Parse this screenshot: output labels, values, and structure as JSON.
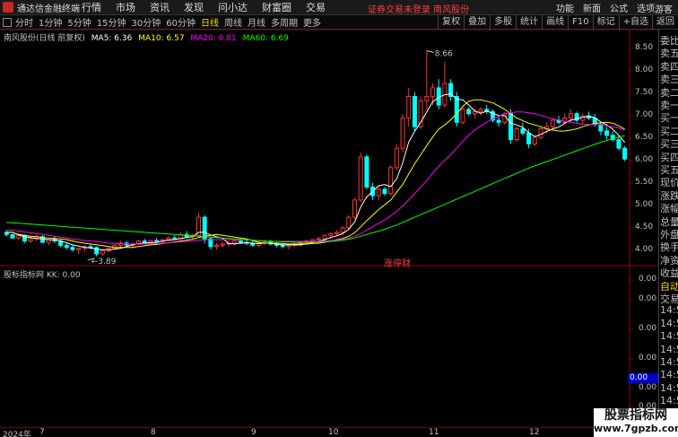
{
  "menubar": {
    "app_title": "通达信金融终端",
    "items": [
      "行情",
      "市场",
      "资讯",
      "发现",
      "问小达",
      "财富圈",
      "交易"
    ],
    "alert": "证券交易未登录  南风股份",
    "right_items": [
      "功能",
      "新面",
      "公式",
      "选项"
    ],
    "guest": "游客"
  },
  "toolbar": {
    "periods": [
      "分时",
      "1分钟",
      "5分钟",
      "15分钟",
      "30分钟",
      "60分钟",
      "日线",
      "周线",
      "月线",
      "多周期",
      "更多"
    ],
    "active_period": 6,
    "tools": [
      "复权",
      "叠加",
      "多股",
      "统计",
      "画线",
      "F10",
      "标记",
      "+自选",
      "返回"
    ]
  },
  "legend": {
    "stock": "南风股份(日线 前复权)",
    "ma5": "MA5: 6.36",
    "ma10": "MA10: 6.57",
    "ma20": "MA20: 6.81",
    "ma60": "MA60: 6.69"
  },
  "indicator": {
    "legend": "股标指标网  KK: 0.00",
    "value_box": "0.00"
  },
  "annotations": {
    "high": "8.66",
    "low": "3.89",
    "zhang_ting": "涨停财"
  },
  "price_axis": [
    "8.50",
    "8.00",
    "7.50",
    "7.00",
    "6.50",
    "6.00",
    "5.50",
    "5.00",
    "4.50",
    "4.00"
  ],
  "ind_axis": [
    "0.00",
    "0.00",
    "0.00",
    "0.00",
    "0.00",
    "0.00",
    "0.00"
  ],
  "side_labels": [
    "委比",
    "卖五",
    "卖四",
    "卖三",
    "卖二",
    "卖一",
    "买一",
    "买二",
    "买三",
    "买四",
    "买五",
    "现价",
    "涨跌",
    "涨幅",
    "总量",
    "外盘",
    "换手",
    "净资",
    "收益",
    "自动",
    "交易",
    "14:56",
    "14:56",
    "14:56",
    "14:56",
    "14:56",
    "14:56",
    "14:56",
    "14:56",
    "14:56"
  ],
  "date_axis": [
    "2024年",
    "7",
    "8",
    "9",
    "10",
    "11",
    "12"
  ],
  "watermark": {
    "line1": "股票指标网",
    "line2": "www.7gpzb.com"
  },
  "colors": {
    "up": "#ff3232",
    "down": "#00ffff",
    "ma5": "#ffffff",
    "ma10": "#ffff00",
    "ma20": "#ff00ff",
    "ma60": "#00ff00"
  },
  "chart_data": {
    "type": "candlestick",
    "ylim": [
      3.7,
      8.9
    ],
    "candles": [
      [
        4.45,
        4.5,
        4.35,
        4.4
      ],
      [
        4.4,
        4.42,
        4.3,
        4.32
      ],
      [
        4.32,
        4.4,
        4.28,
        4.38
      ],
      [
        4.38,
        4.4,
        4.2,
        4.25
      ],
      [
        4.25,
        4.35,
        4.2,
        4.3
      ],
      [
        4.3,
        4.4,
        4.25,
        4.35
      ],
      [
        4.35,
        4.38,
        4.2,
        4.22
      ],
      [
        4.22,
        4.3,
        4.15,
        4.28
      ],
      [
        4.28,
        4.35,
        4.2,
        4.25
      ],
      [
        4.25,
        4.3,
        4.1,
        4.15
      ],
      [
        4.15,
        4.2,
        4.05,
        4.1
      ],
      [
        4.1,
        4.15,
        4.0,
        4.05
      ],
      [
        4.05,
        4.1,
        3.95,
        4.08
      ],
      [
        4.08,
        4.15,
        4.0,
        4.12
      ],
      [
        4.12,
        4.18,
        4.05,
        4.1
      ],
      [
        4.1,
        4.12,
        3.89,
        3.95
      ],
      [
        3.95,
        4.05,
        3.9,
        4.02
      ],
      [
        4.02,
        4.1,
        3.98,
        4.08
      ],
      [
        4.08,
        4.18,
        4.05,
        4.15
      ],
      [
        4.15,
        4.25,
        4.1,
        4.2
      ],
      [
        4.2,
        4.25,
        4.12,
        4.15
      ],
      [
        4.15,
        4.2,
        4.08,
        4.18
      ],
      [
        4.18,
        4.28,
        4.15,
        4.25
      ],
      [
        4.25,
        4.3,
        4.2,
        4.22
      ],
      [
        4.22,
        4.28,
        4.18,
        4.26
      ],
      [
        4.26,
        4.32,
        4.2,
        4.24
      ],
      [
        4.24,
        4.3,
        4.2,
        4.28
      ],
      [
        4.28,
        4.35,
        4.25,
        4.32
      ],
      [
        4.32,
        4.38,
        4.28,
        4.3
      ],
      [
        4.3,
        4.45,
        4.28,
        4.4
      ],
      [
        4.4,
        4.48,
        4.32,
        4.35
      ],
      [
        4.35,
        4.42,
        4.3,
        4.38
      ],
      [
        4.38,
        4.9,
        4.35,
        4.8
      ],
      [
        4.8,
        4.85,
        4.2,
        4.3
      ],
      [
        4.3,
        4.35,
        4.05,
        4.12
      ],
      [
        4.12,
        4.2,
        4.05,
        4.15
      ],
      [
        4.15,
        4.22,
        4.1,
        4.18
      ],
      [
        4.18,
        4.25,
        4.12,
        4.2
      ],
      [
        4.2,
        4.28,
        4.15,
        4.25
      ],
      [
        4.25,
        4.3,
        4.18,
        4.22
      ],
      [
        4.22,
        4.28,
        4.15,
        4.2
      ],
      [
        4.2,
        4.25,
        4.12,
        4.15
      ],
      [
        4.15,
        4.22,
        4.1,
        4.2
      ],
      [
        4.2,
        4.28,
        4.15,
        4.22
      ],
      [
        4.22,
        4.28,
        4.15,
        4.18
      ],
      [
        4.18,
        4.22,
        4.1,
        4.15
      ],
      [
        4.15,
        4.2,
        4.08,
        4.12
      ],
      [
        4.12,
        4.18,
        4.05,
        4.15
      ],
      [
        4.15,
        4.2,
        4.1,
        4.18
      ],
      [
        4.18,
        4.25,
        4.12,
        4.2
      ],
      [
        4.2,
        4.28,
        4.15,
        4.25
      ],
      [
        4.25,
        4.3,
        4.2,
        4.28
      ],
      [
        4.28,
        4.35,
        4.22,
        4.3
      ],
      [
        4.3,
        4.4,
        4.25,
        4.38
      ],
      [
        4.38,
        4.45,
        4.3,
        4.42
      ],
      [
        4.42,
        4.5,
        4.35,
        4.45
      ],
      [
        4.45,
        4.6,
        4.4,
        4.55
      ],
      [
        4.55,
        4.85,
        4.5,
        4.8
      ],
      [
        4.8,
        5.25,
        4.75,
        5.2
      ],
      [
        5.2,
        6.3,
        5.15,
        6.2
      ],
      [
        6.2,
        6.25,
        5.45,
        5.5
      ],
      [
        5.5,
        5.6,
        5.2,
        5.3
      ],
      [
        5.3,
        5.5,
        5.2,
        5.45
      ],
      [
        5.45,
        5.5,
        5.3,
        5.35
      ],
      [
        5.35,
        6.0,
        5.3,
        5.95
      ],
      [
        5.95,
        6.5,
        5.9,
        6.4
      ],
      [
        6.4,
        7.2,
        6.3,
        7.1
      ],
      [
        7.1,
        7.8,
        6.9,
        7.6
      ],
      [
        7.6,
        7.7,
        6.8,
        6.9
      ],
      [
        6.9,
        7.6,
        6.85,
        7.5
      ],
      [
        7.5,
        8.66,
        7.3,
        7.6
      ],
      [
        7.6,
        7.9,
        7.4,
        7.8
      ],
      [
        7.8,
        8.0,
        7.3,
        7.4
      ],
      [
        7.4,
        8.4,
        7.35,
        7.9
      ],
      [
        7.9,
        8.0,
        7.5,
        7.6
      ],
      [
        7.6,
        7.7,
        6.9,
        7.0
      ],
      [
        7.0,
        7.4,
        6.95,
        7.3
      ],
      [
        7.3,
        7.35,
        7.15,
        7.2
      ],
      [
        7.2,
        7.3,
        7.1,
        7.25
      ],
      [
        7.25,
        7.35,
        7.15,
        7.3
      ],
      [
        7.3,
        7.4,
        7.2,
        7.25
      ],
      [
        7.25,
        7.3,
        7.0,
        7.05
      ],
      [
        7.05,
        7.15,
        6.9,
        7.0
      ],
      [
        7.0,
        7.25,
        6.95,
        7.2
      ],
      [
        7.2,
        7.3,
        6.5,
        6.6
      ],
      [
        6.6,
        6.9,
        6.55,
        6.85
      ],
      [
        6.85,
        7.0,
        6.7,
        6.75
      ],
      [
        6.75,
        6.85,
        6.4,
        6.5
      ],
      [
        6.5,
        6.7,
        6.45,
        6.65
      ],
      [
        6.65,
        6.9,
        6.6,
        6.85
      ],
      [
        6.85,
        7.0,
        6.75,
        6.9
      ],
      [
        6.9,
        7.1,
        6.85,
        7.05
      ],
      [
        7.05,
        7.15,
        6.95,
        7.0
      ],
      [
        7.0,
        7.2,
        6.95,
        7.1
      ],
      [
        7.1,
        7.3,
        7.0,
        7.2
      ],
      [
        7.2,
        7.25,
        7.0,
        7.05
      ],
      [
        7.05,
        7.2,
        6.95,
        7.15
      ],
      [
        7.15,
        7.25,
        7.05,
        7.1
      ],
      [
        7.1,
        7.2,
        6.9,
        6.95
      ],
      [
        6.95,
        7.0,
        6.7,
        6.8
      ],
      [
        6.8,
        6.9,
        6.6,
        6.7
      ],
      [
        6.7,
        6.8,
        6.55,
        6.6
      ],
      [
        6.6,
        6.7,
        6.35,
        6.4
      ],
      [
        6.4,
        6.45,
        6.1,
        6.15
      ]
    ],
    "ma_series": [
      {
        "name": "MA5",
        "values": [
          4.45,
          4.45,
          4.39,
          4.35,
          4.33,
          4.31,
          4.3,
          4.28,
          4.28,
          4.25,
          4.21,
          4.16,
          4.13,
          4.1,
          4.09,
          4.06,
          4.05,
          4.05,
          4.06,
          4.08,
          4.12,
          4.16,
          4.19,
          4.2,
          4.21,
          4.22,
          4.25,
          4.27,
          4.28,
          4.31,
          4.33,
          4.35,
          4.45,
          4.45,
          4.39,
          4.35,
          4.31,
          4.19,
          4.18,
          4.2,
          4.21,
          4.2,
          4.19,
          4.2,
          4.2,
          4.18,
          4.16,
          4.16,
          4.16,
          4.16,
          4.18,
          4.21,
          4.24,
          4.28,
          4.33,
          4.37,
          4.42,
          4.52,
          4.69,
          5.04,
          5.27,
          5.4,
          5.53,
          5.56,
          5.51,
          5.69,
          6.06,
          6.54,
          6.79,
          7.0,
          7.24,
          7.48,
          7.58,
          7.64,
          7.66,
          7.54,
          7.52,
          7.4,
          7.27,
          7.21,
          7.26,
          7.21,
          7.16,
          7.16,
          6.98,
          6.94,
          6.88,
          6.76,
          6.67,
          6.72,
          6.79,
          6.85,
          6.89,
          6.98,
          7.05,
          7.08,
          7.12,
          7.14,
          7.11,
          7.01,
          6.94,
          6.84,
          6.7,
          6.53
        ],
        "color_key": "ma5"
      },
      {
        "name": "MA10",
        "values": [
          4.45,
          4.45,
          4.4,
          4.38,
          4.36,
          4.35,
          4.33,
          4.32,
          4.31,
          4.3,
          4.28,
          4.25,
          4.22,
          4.2,
          4.18,
          4.16,
          4.14,
          4.12,
          4.1,
          4.1,
          4.1,
          4.1,
          4.12,
          4.14,
          4.16,
          4.17,
          4.19,
          4.21,
          4.23,
          4.25,
          4.27,
          4.29,
          4.33,
          4.36,
          4.38,
          4.4,
          4.38,
          4.36,
          4.34,
          4.32,
          4.3,
          4.26,
          4.22,
          4.2,
          4.2,
          4.2,
          4.19,
          4.18,
          4.18,
          4.18,
          4.18,
          4.19,
          4.2,
          4.22,
          4.25,
          4.28,
          4.31,
          4.36,
          4.44,
          4.58,
          4.72,
          4.85,
          4.98,
          5.09,
          5.2,
          5.38,
          5.56,
          5.8,
          6.04,
          6.25,
          6.46,
          6.66,
          6.84,
          6.94,
          7.06,
          7.2,
          7.37,
          7.49,
          7.52,
          7.52,
          7.49,
          7.45,
          7.38,
          7.3,
          7.2,
          7.1,
          7.04,
          6.98,
          6.94,
          6.9,
          6.85,
          6.82,
          6.8,
          6.8,
          6.82,
          6.85,
          6.9,
          6.94,
          6.97,
          6.99,
          7.0,
          6.98,
          6.92,
          6.84
        ],
        "color_key": "ma10"
      },
      {
        "name": "MA20",
        "values": [
          4.5,
          4.5,
          4.48,
          4.46,
          4.44,
          4.42,
          4.4,
          4.38,
          4.36,
          4.34,
          4.32,
          4.3,
          4.28,
          4.26,
          4.25,
          4.24,
          4.22,
          4.2,
          4.19,
          4.18,
          4.18,
          4.18,
          4.18,
          4.18,
          4.18,
          4.19,
          4.2,
          4.21,
          4.22,
          4.23,
          4.24,
          4.25,
          4.27,
          4.28,
          4.28,
          4.28,
          4.28,
          4.28,
          4.28,
          4.28,
          4.28,
          4.27,
          4.26,
          4.25,
          4.24,
          4.24,
          4.24,
          4.24,
          4.24,
          4.24,
          4.24,
          4.24,
          4.24,
          4.25,
          4.26,
          4.27,
          4.29,
          4.32,
          4.36,
          4.42,
          4.5,
          4.58,
          4.66,
          4.74,
          4.83,
          4.94,
          5.06,
          5.2,
          5.35,
          5.5,
          5.65,
          5.82,
          5.98,
          6.12,
          6.25,
          6.4,
          6.56,
          6.7,
          6.82,
          6.92,
          7.0,
          7.08,
          7.14,
          7.2,
          7.22,
          7.24,
          7.24,
          7.22,
          7.2,
          7.16,
          7.12,
          7.08,
          7.05,
          7.02,
          7.0,
          6.98,
          6.96,
          6.95,
          6.95,
          6.94,
          6.92,
          6.9,
          6.87,
          6.82
        ],
        "color_key": "ma20"
      },
      {
        "name": "MA60",
        "values": [
          4.68,
          4.67,
          4.66,
          4.65,
          4.64,
          4.63,
          4.62,
          4.61,
          4.6,
          4.59,
          4.58,
          4.57,
          4.56,
          4.55,
          4.54,
          4.53,
          4.52,
          4.51,
          4.5,
          4.49,
          4.48,
          4.47,
          4.46,
          4.45,
          4.44,
          4.43,
          4.42,
          4.41,
          4.4,
          4.39,
          4.38,
          4.37,
          4.36,
          4.35,
          4.34,
          4.33,
          4.32,
          4.31,
          4.3,
          4.29,
          4.28,
          4.27,
          4.26,
          4.25,
          4.24,
          4.24,
          4.23,
          4.23,
          4.22,
          4.22,
          4.22,
          4.22,
          4.22,
          4.23,
          4.24,
          4.25,
          4.27,
          4.29,
          4.32,
          4.36,
          4.4,
          4.44,
          4.48,
          4.52,
          4.57,
          4.62,
          4.68,
          4.74,
          4.8,
          4.86,
          4.92,
          4.98,
          5.04,
          5.1,
          5.16,
          5.22,
          5.28,
          5.34,
          5.4,
          5.46,
          5.52,
          5.58,
          5.64,
          5.7,
          5.76,
          5.82,
          5.88,
          5.94,
          5.99,
          6.04,
          6.09,
          6.14,
          6.19,
          6.24,
          6.29,
          6.34,
          6.39,
          6.44,
          6.49,
          6.54,
          6.58,
          6.62,
          6.66,
          6.69
        ],
        "color_key": "ma60"
      }
    ]
  }
}
